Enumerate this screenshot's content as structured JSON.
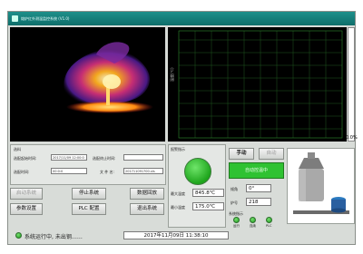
{
  "window": {
    "title": "熔炉红外测温监控系统  (V1.0)"
  },
  "gauge": {
    "percent_label": "0.0%",
    "level": 0.0
  },
  "chart": {
    "ylabel": "温度(℃)"
  },
  "params": {
    "section_label": "选料",
    "start_time_label": "选配起始时间:",
    "start_time_value": "2017/11/09 12:00:0",
    "end_time_label": "选配终止时间:",
    "end_time_value": "",
    "duration_label": "选配时间:",
    "duration_value": "00:0:0",
    "file_label": "文 件 名:",
    "file_value": "201711091700.xls"
  },
  "buttons": {
    "start": "启动系统",
    "stop": "停止系统",
    "replay": "数据回放",
    "params": "参数设置",
    "plc": "PLC 配置",
    "exit": "退出系统",
    "manual": "手动",
    "auto": "自动"
  },
  "alarm": {
    "label": "报警指示"
  },
  "readings": {
    "max_temp_label": "最大温度",
    "max_temp_value": "845.8℃",
    "min_temp_label": "最小温度",
    "min_temp_value": "175.0℃"
  },
  "mode": {
    "auto_control_text": "自动控温中"
  },
  "tilt": {
    "angle_label": "倾角",
    "angle_value": "0°",
    "furnace_no_label": "炉号",
    "furnace_no_value": "218"
  },
  "indicators": {
    "label": "系统指示",
    "items": [
      "运行",
      "连续",
      "PLC"
    ]
  },
  "status": {
    "message": "系统运行中, 未出钢……",
    "datetime": "2017年11月09日   11:38:10"
  },
  "colors": {
    "titlebar": "#0f6e6a",
    "status_ok": "#1ea51c",
    "auto_box": "#2fc232"
  }
}
